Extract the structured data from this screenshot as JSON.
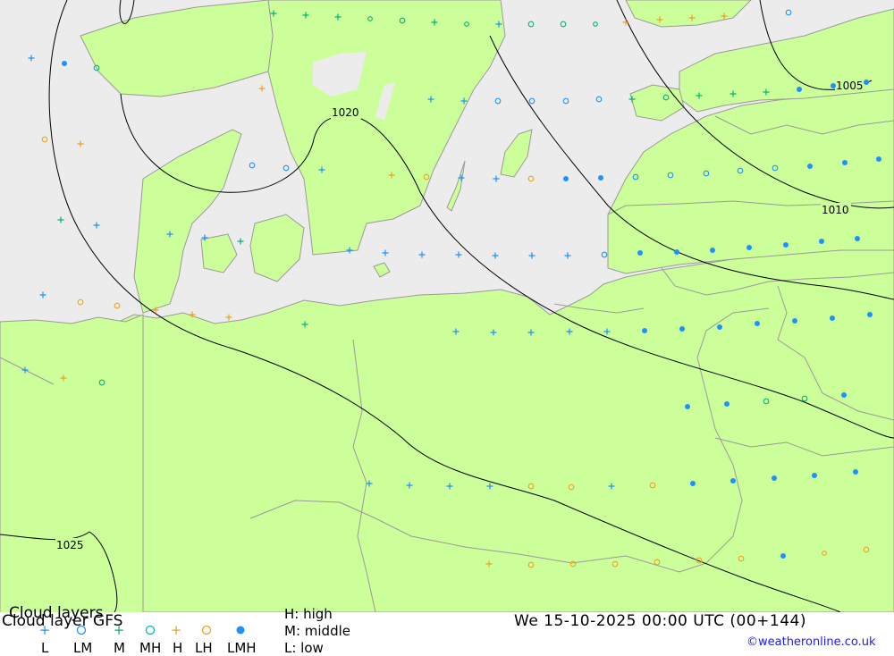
{
  "footer": {
    "title_line1": "Cloud layers",
    "title_line2": "Cloud layer   GFS",
    "legend_labels": [
      "L",
      "LM",
      "M",
      "MH",
      "H",
      "LH",
      "LMH"
    ],
    "legend_colors": [
      "#1e90ff",
      "#1e90ff",
      "#00b27a",
      "#00b2c8",
      "#f0a020",
      "#f0a020",
      "#1e90ff"
    ],
    "key_high": "H: high",
    "key_middle": "M: middle",
    "key_low": "L: low",
    "datetime": "We 15-10-2025 00:00 UTC (00+144)",
    "copyright": "©weatheronline.co.uk"
  },
  "map": {
    "land_color": "#ccff99",
    "sea_color": "#ececec",
    "isobar_labels": [
      "1020",
      "1005",
      "1010",
      "1025"
    ]
  }
}
